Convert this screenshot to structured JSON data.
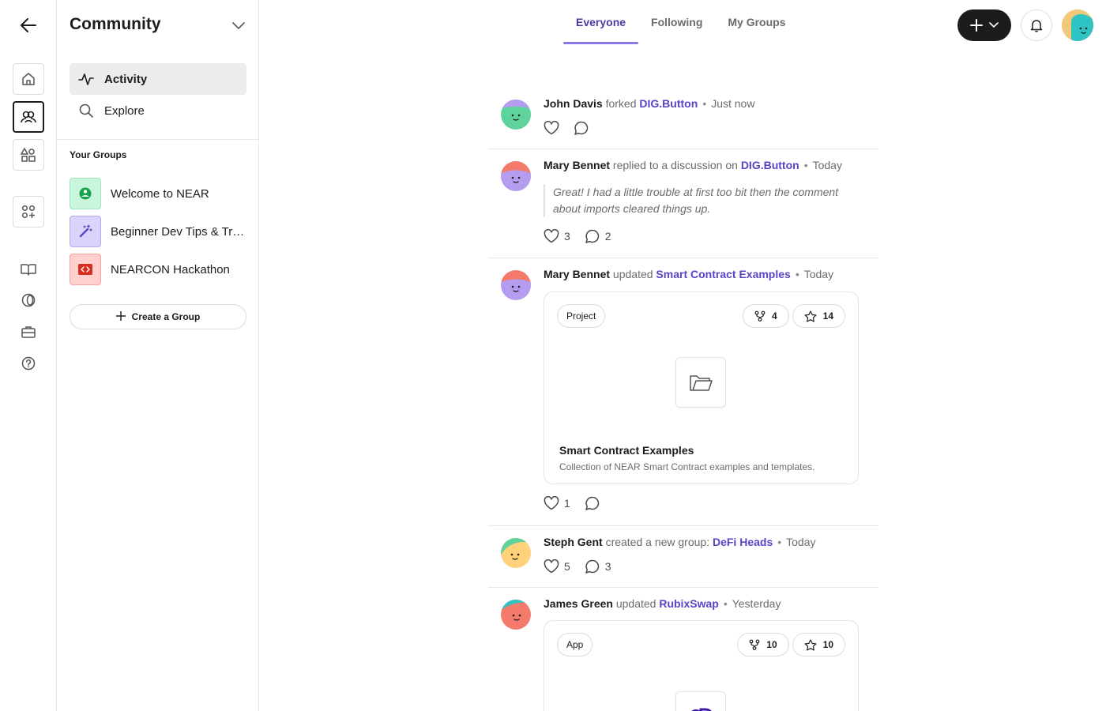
{
  "rail": {
    "icons": [
      "arrow-left-icon",
      "home-icon",
      "community-icon",
      "shapes-icon",
      "apps-icon",
      "book-icon",
      "coin-icon",
      "briefcase-icon",
      "help-icon"
    ]
  },
  "sidebar": {
    "title": "Community",
    "nav": [
      {
        "label": "Activity",
        "icon": "activity-icon"
      },
      {
        "label": "Explore",
        "icon": "search-icon"
      }
    ],
    "groups_heading": "Your Groups",
    "groups": [
      {
        "name": "Welcome to NEAR",
        "color": "#c9f5dc",
        "icon": "near-icon"
      },
      {
        "name": "Beginner Dev Tips & Tricks",
        "color": "#d9d4fb",
        "icon": "magic-wand-icon"
      },
      {
        "name": "NEARCON Hackathon",
        "color": "#ffd0cc",
        "icon": "code-icon"
      }
    ],
    "create_label": "Create a Group"
  },
  "tabs": [
    "Everyone",
    "Following",
    "My Groups"
  ],
  "colors": {
    "accent": "#5b41c7",
    "tab_underline": "#8a78e6"
  },
  "feed": [
    {
      "user": "John Davis",
      "verb": "forked",
      "target": "DIG.Button",
      "time": "Just now",
      "likes": "",
      "comments": ""
    },
    {
      "user": "Mary Bennet",
      "verb": "replied to a discussion on",
      "target": "DIG.Button",
      "time": "Today",
      "quote": "Great! I had a little trouble at first too bit then the comment about imports cleared things up.",
      "likes": "3",
      "comments": "2"
    },
    {
      "user": "Mary Bennet",
      "verb": "updated",
      "target": "Smart Contract Examples",
      "time": "Today",
      "card": {
        "type": "Project",
        "forks": "4",
        "stars": "14",
        "name": "Smart Contract Examples",
        "description": "Collection of NEAR Smart Contract examples and templates."
      },
      "likes": "1",
      "comments": ""
    },
    {
      "user": "Steph Gent",
      "verb": "created a new group:",
      "target": "DeFi Heads",
      "time": "Today",
      "likes": "5",
      "comments": "3"
    },
    {
      "user": "James Green",
      "verb": "updated",
      "target": "RubixSwap",
      "time": "Yesterday",
      "card": {
        "type": "App",
        "forks": "10",
        "stars": "10"
      }
    }
  ]
}
